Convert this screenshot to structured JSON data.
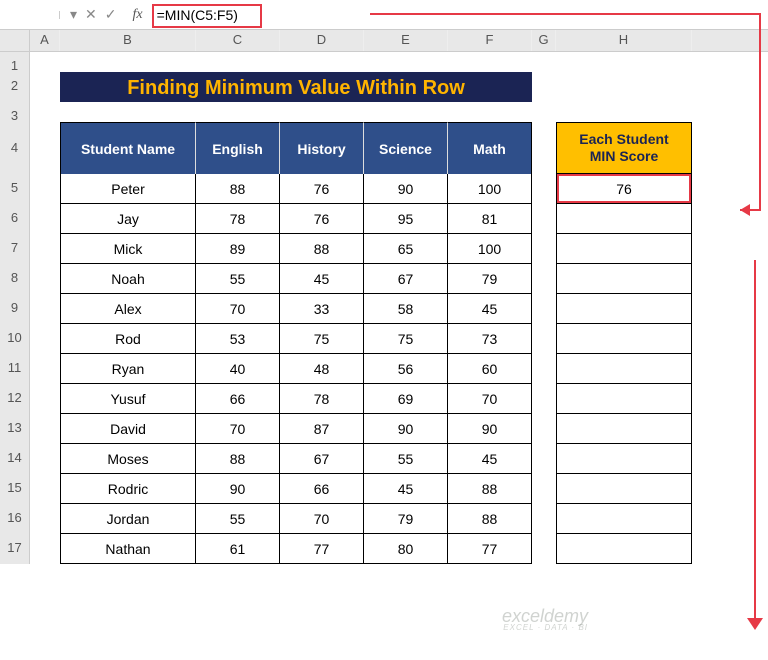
{
  "formula_bar": {
    "name_box": "",
    "cancel_icon": "✕",
    "enter_icon": "✓",
    "fx_label": "fx",
    "formula": "=MIN(C5:F5)"
  },
  "columns": {
    "A": "A",
    "B": "B",
    "C": "C",
    "D": "D",
    "E": "E",
    "F": "F",
    "G": "G",
    "H": "H"
  },
  "row_numbers": [
    "1",
    "2",
    "3",
    "4",
    "5",
    "6",
    "7",
    "8",
    "9",
    "10",
    "11",
    "12",
    "13",
    "14",
    "15",
    "16",
    "17"
  ],
  "title": "Finding Minimum Value Within Row",
  "table_headers": {
    "name": "Student Name",
    "english": "English",
    "history": "History",
    "science": "Science",
    "math": "Math"
  },
  "min_header": {
    "line1": "Each Student",
    "line2": "MIN Score"
  },
  "students": [
    {
      "name": "Peter",
      "english": "88",
      "history": "76",
      "science": "90",
      "math": "100",
      "min": "76"
    },
    {
      "name": "Jay",
      "english": "78",
      "history": "76",
      "science": "95",
      "math": "81",
      "min": ""
    },
    {
      "name": "Mick",
      "english": "89",
      "history": "88",
      "science": "65",
      "math": "100",
      "min": ""
    },
    {
      "name": "Noah",
      "english": "55",
      "history": "45",
      "science": "67",
      "math": "79",
      "min": ""
    },
    {
      "name": "Alex",
      "english": "70",
      "history": "33",
      "science": "58",
      "math": "45",
      "min": ""
    },
    {
      "name": "Rod",
      "english": "53",
      "history": "75",
      "science": "75",
      "math": "73",
      "min": ""
    },
    {
      "name": "Ryan",
      "english": "40",
      "history": "48",
      "science": "56",
      "math": "60",
      "min": ""
    },
    {
      "name": "Yusuf",
      "english": "66",
      "history": "78",
      "science": "69",
      "math": "70",
      "min": ""
    },
    {
      "name": "David",
      "english": "70",
      "history": "87",
      "science": "90",
      "math": "90",
      "min": ""
    },
    {
      "name": "Moses",
      "english": "88",
      "history": "67",
      "science": "55",
      "math": "45",
      "min": ""
    },
    {
      "name": "Rodric",
      "english": "90",
      "history": "66",
      "science": "45",
      "math": "88",
      "min": ""
    },
    {
      "name": "Jordan",
      "english": "55",
      "history": "70",
      "science": "79",
      "math": "88",
      "min": ""
    },
    {
      "name": "Nathan",
      "english": "61",
      "history": "77",
      "science": "80",
      "math": "77",
      "min": ""
    }
  ],
  "watermark": {
    "brand": "exceldemy",
    "sub": "EXCEL · DATA · BI"
  },
  "colors": {
    "accent_red": "#e63946",
    "navy_header": "#2f4f8a",
    "title_bg": "#1b2454",
    "title_fg": "#ffb400",
    "min_bg": "#ffbf00"
  }
}
